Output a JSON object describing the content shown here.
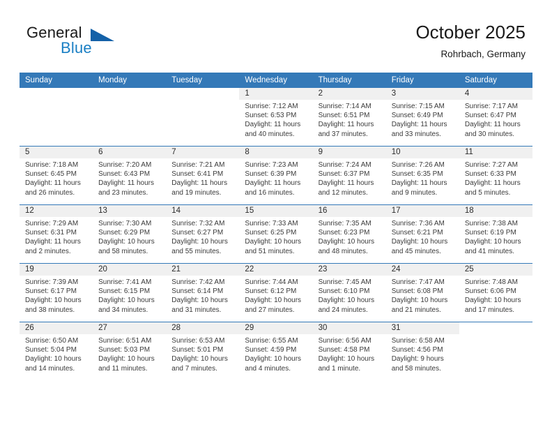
{
  "brand": {
    "name_part1": "General",
    "name_part2": "Blue",
    "triangle_color": "#1461a8",
    "blue_color": "#1a7fc4"
  },
  "header": {
    "title": "October 2025",
    "subtitle": "Rohrbach, Germany"
  },
  "theme": {
    "header_bar_color": "#3479b8",
    "daynum_band_color": "#f0f0f0",
    "row_separator_color": "#3479b8"
  },
  "columns": [
    "Sunday",
    "Monday",
    "Tuesday",
    "Wednesday",
    "Thursday",
    "Friday",
    "Saturday"
  ],
  "weeks": [
    [
      {
        "day": "",
        "sunrise": "",
        "sunset": "",
        "daylight_line1": "",
        "daylight_line2": "",
        "blank": true
      },
      {
        "day": "",
        "sunrise": "",
        "sunset": "",
        "daylight_line1": "",
        "daylight_line2": "",
        "blank": true
      },
      {
        "day": "",
        "sunrise": "",
        "sunset": "",
        "daylight_line1": "",
        "daylight_line2": "",
        "blank": true
      },
      {
        "day": "1",
        "sunrise": "Sunrise: 7:12 AM",
        "sunset": "Sunset: 6:53 PM",
        "daylight_line1": "Daylight: 11 hours",
        "daylight_line2": "and 40 minutes."
      },
      {
        "day": "2",
        "sunrise": "Sunrise: 7:14 AM",
        "sunset": "Sunset: 6:51 PM",
        "daylight_line1": "Daylight: 11 hours",
        "daylight_line2": "and 37 minutes."
      },
      {
        "day": "3",
        "sunrise": "Sunrise: 7:15 AM",
        "sunset": "Sunset: 6:49 PM",
        "daylight_line1": "Daylight: 11 hours",
        "daylight_line2": "and 33 minutes."
      },
      {
        "day": "4",
        "sunrise": "Sunrise: 7:17 AM",
        "sunset": "Sunset: 6:47 PM",
        "daylight_line1": "Daylight: 11 hours",
        "daylight_line2": "and 30 minutes."
      }
    ],
    [
      {
        "day": "5",
        "sunrise": "Sunrise: 7:18 AM",
        "sunset": "Sunset: 6:45 PM",
        "daylight_line1": "Daylight: 11 hours",
        "daylight_line2": "and 26 minutes."
      },
      {
        "day": "6",
        "sunrise": "Sunrise: 7:20 AM",
        "sunset": "Sunset: 6:43 PM",
        "daylight_line1": "Daylight: 11 hours",
        "daylight_line2": "and 23 minutes."
      },
      {
        "day": "7",
        "sunrise": "Sunrise: 7:21 AM",
        "sunset": "Sunset: 6:41 PM",
        "daylight_line1": "Daylight: 11 hours",
        "daylight_line2": "and 19 minutes."
      },
      {
        "day": "8",
        "sunrise": "Sunrise: 7:23 AM",
        "sunset": "Sunset: 6:39 PM",
        "daylight_line1": "Daylight: 11 hours",
        "daylight_line2": "and 16 minutes."
      },
      {
        "day": "9",
        "sunrise": "Sunrise: 7:24 AM",
        "sunset": "Sunset: 6:37 PM",
        "daylight_line1": "Daylight: 11 hours",
        "daylight_line2": "and 12 minutes."
      },
      {
        "day": "10",
        "sunrise": "Sunrise: 7:26 AM",
        "sunset": "Sunset: 6:35 PM",
        "daylight_line1": "Daylight: 11 hours",
        "daylight_line2": "and 9 minutes."
      },
      {
        "day": "11",
        "sunrise": "Sunrise: 7:27 AM",
        "sunset": "Sunset: 6:33 PM",
        "daylight_line1": "Daylight: 11 hours",
        "daylight_line2": "and 5 minutes."
      }
    ],
    [
      {
        "day": "12",
        "sunrise": "Sunrise: 7:29 AM",
        "sunset": "Sunset: 6:31 PM",
        "daylight_line1": "Daylight: 11 hours",
        "daylight_line2": "and 2 minutes."
      },
      {
        "day": "13",
        "sunrise": "Sunrise: 7:30 AM",
        "sunset": "Sunset: 6:29 PM",
        "daylight_line1": "Daylight: 10 hours",
        "daylight_line2": "and 58 minutes."
      },
      {
        "day": "14",
        "sunrise": "Sunrise: 7:32 AM",
        "sunset": "Sunset: 6:27 PM",
        "daylight_line1": "Daylight: 10 hours",
        "daylight_line2": "and 55 minutes."
      },
      {
        "day": "15",
        "sunrise": "Sunrise: 7:33 AM",
        "sunset": "Sunset: 6:25 PM",
        "daylight_line1": "Daylight: 10 hours",
        "daylight_line2": "and 51 minutes."
      },
      {
        "day": "16",
        "sunrise": "Sunrise: 7:35 AM",
        "sunset": "Sunset: 6:23 PM",
        "daylight_line1": "Daylight: 10 hours",
        "daylight_line2": "and 48 minutes."
      },
      {
        "day": "17",
        "sunrise": "Sunrise: 7:36 AM",
        "sunset": "Sunset: 6:21 PM",
        "daylight_line1": "Daylight: 10 hours",
        "daylight_line2": "and 45 minutes."
      },
      {
        "day": "18",
        "sunrise": "Sunrise: 7:38 AM",
        "sunset": "Sunset: 6:19 PM",
        "daylight_line1": "Daylight: 10 hours",
        "daylight_line2": "and 41 minutes."
      }
    ],
    [
      {
        "day": "19",
        "sunrise": "Sunrise: 7:39 AM",
        "sunset": "Sunset: 6:17 PM",
        "daylight_line1": "Daylight: 10 hours",
        "daylight_line2": "and 38 minutes."
      },
      {
        "day": "20",
        "sunrise": "Sunrise: 7:41 AM",
        "sunset": "Sunset: 6:15 PM",
        "daylight_line1": "Daylight: 10 hours",
        "daylight_line2": "and 34 minutes."
      },
      {
        "day": "21",
        "sunrise": "Sunrise: 7:42 AM",
        "sunset": "Sunset: 6:14 PM",
        "daylight_line1": "Daylight: 10 hours",
        "daylight_line2": "and 31 minutes."
      },
      {
        "day": "22",
        "sunrise": "Sunrise: 7:44 AM",
        "sunset": "Sunset: 6:12 PM",
        "daylight_line1": "Daylight: 10 hours",
        "daylight_line2": "and 27 minutes."
      },
      {
        "day": "23",
        "sunrise": "Sunrise: 7:45 AM",
        "sunset": "Sunset: 6:10 PM",
        "daylight_line1": "Daylight: 10 hours",
        "daylight_line2": "and 24 minutes."
      },
      {
        "day": "24",
        "sunrise": "Sunrise: 7:47 AM",
        "sunset": "Sunset: 6:08 PM",
        "daylight_line1": "Daylight: 10 hours",
        "daylight_line2": "and 21 minutes."
      },
      {
        "day": "25",
        "sunrise": "Sunrise: 7:48 AM",
        "sunset": "Sunset: 6:06 PM",
        "daylight_line1": "Daylight: 10 hours",
        "daylight_line2": "and 17 minutes."
      }
    ],
    [
      {
        "day": "26",
        "sunrise": "Sunrise: 6:50 AM",
        "sunset": "Sunset: 5:04 PM",
        "daylight_line1": "Daylight: 10 hours",
        "daylight_line2": "and 14 minutes."
      },
      {
        "day": "27",
        "sunrise": "Sunrise: 6:51 AM",
        "sunset": "Sunset: 5:03 PM",
        "daylight_line1": "Daylight: 10 hours",
        "daylight_line2": "and 11 minutes."
      },
      {
        "day": "28",
        "sunrise": "Sunrise: 6:53 AM",
        "sunset": "Sunset: 5:01 PM",
        "daylight_line1": "Daylight: 10 hours",
        "daylight_line2": "and 7 minutes."
      },
      {
        "day": "29",
        "sunrise": "Sunrise: 6:55 AM",
        "sunset": "Sunset: 4:59 PM",
        "daylight_line1": "Daylight: 10 hours",
        "daylight_line2": "and 4 minutes."
      },
      {
        "day": "30",
        "sunrise": "Sunrise: 6:56 AM",
        "sunset": "Sunset: 4:58 PM",
        "daylight_line1": "Daylight: 10 hours",
        "daylight_line2": "and 1 minute."
      },
      {
        "day": "31",
        "sunrise": "Sunrise: 6:58 AM",
        "sunset": "Sunset: 4:56 PM",
        "daylight_line1": "Daylight: 9 hours",
        "daylight_line2": "and 58 minutes."
      },
      {
        "day": "",
        "sunrise": "",
        "sunset": "",
        "daylight_line1": "",
        "daylight_line2": "",
        "blank": true
      }
    ]
  ]
}
